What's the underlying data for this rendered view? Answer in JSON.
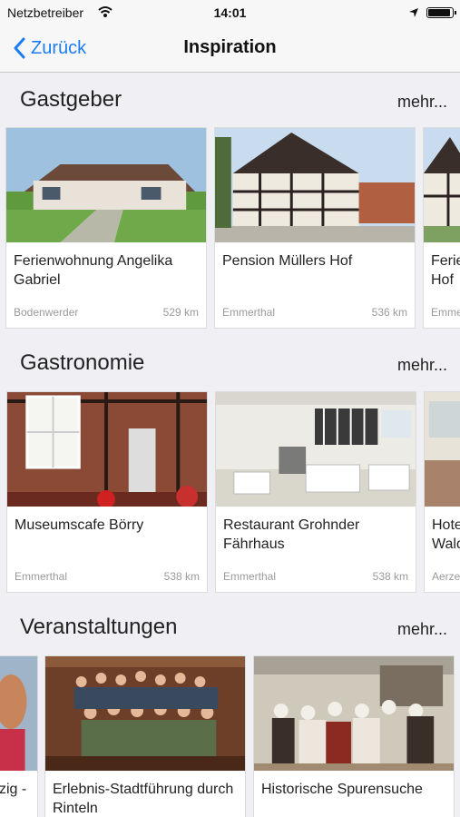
{
  "status": {
    "carrier": "Netzbetreiber",
    "time": "14:01"
  },
  "nav": {
    "back_label": "Zurück",
    "title": "Inspiration"
  },
  "sections": [
    {
      "title": "Gastgeber",
      "more": "mehr...",
      "cards": [
        {
          "name": "Ferienwohnung Angelika Gabriel",
          "place": "Bodenwerder",
          "distance": "529 km"
        },
        {
          "name": "Pension Müllers Hof",
          "place": "Emmerthal",
          "distance": "536 km"
        },
        {
          "name": "Ferien Hof",
          "place": "Emme",
          "distance": ""
        }
      ]
    },
    {
      "title": "Gastronomie",
      "more": "mehr...",
      "cards": [
        {
          "name": "Museumscafe Börry",
          "place": "Emmerthal",
          "distance": "538 km"
        },
        {
          "name": "Restaurant Grohnder Fährhaus",
          "place": "Emmerthal",
          "distance": "538 km"
        },
        {
          "name": "Hote Wald",
          "place": "Aerze",
          "distance": ""
        }
      ]
    },
    {
      "title": "Veranstaltungen",
      "more": "mehr...",
      "cards": [
        {
          "name": "zig -",
          "place": "",
          "distance": ""
        },
        {
          "name": "Erlebnis-Stadtführung durch Rinteln",
          "place": "",
          "distance": ""
        },
        {
          "name": "Historische Spurensuche",
          "place": "",
          "distance": ""
        }
      ]
    }
  ]
}
